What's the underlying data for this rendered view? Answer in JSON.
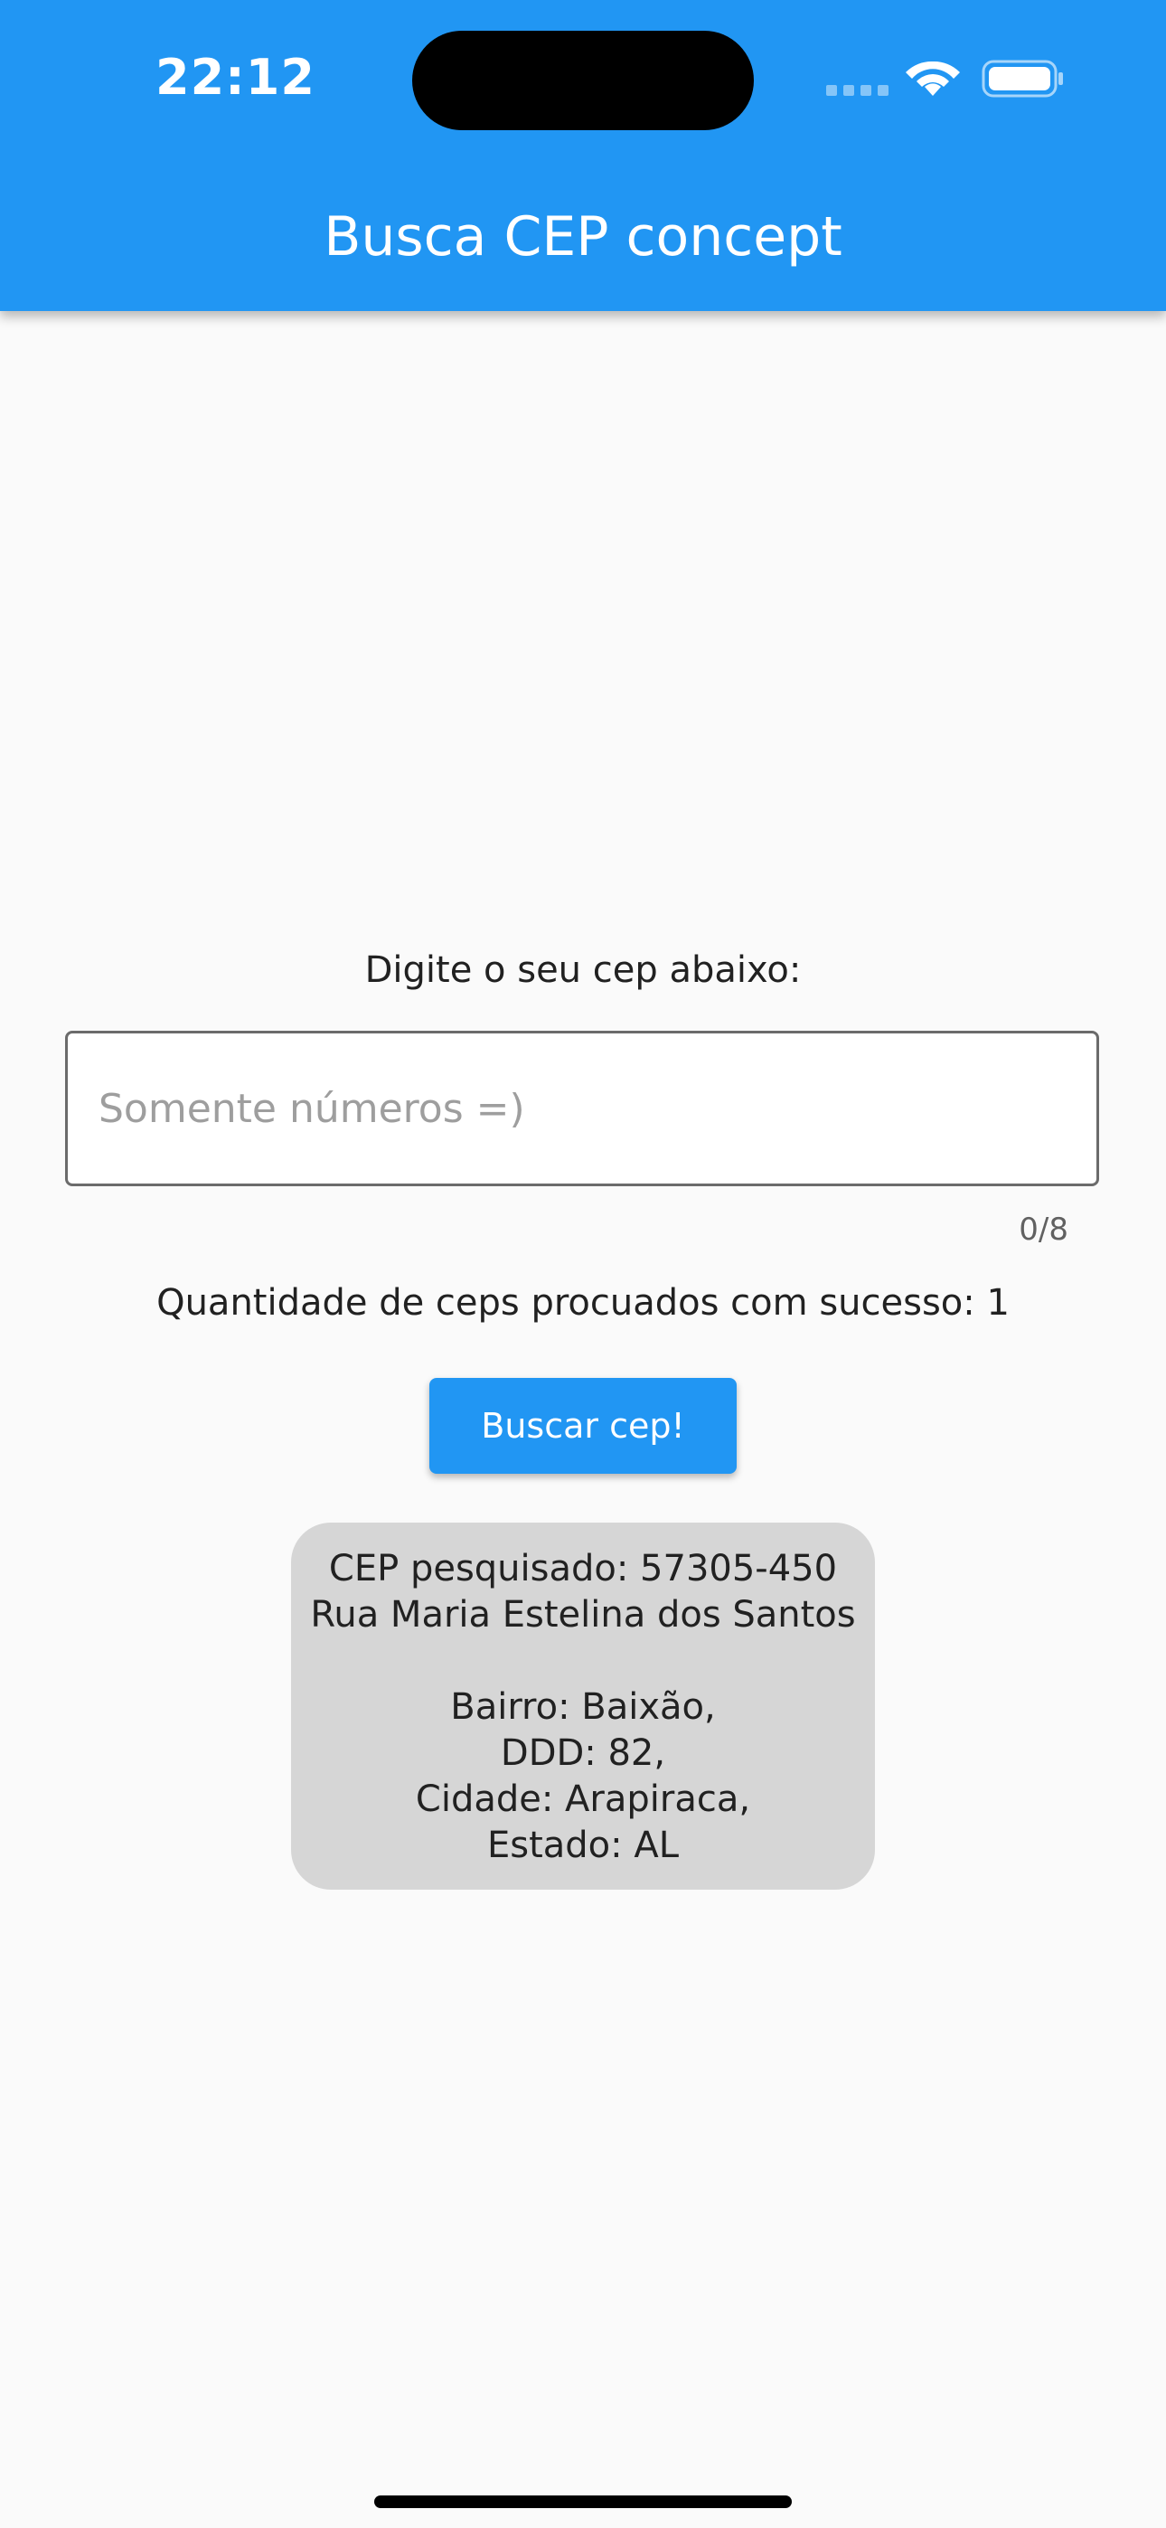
{
  "status_bar": {
    "time": "22:12"
  },
  "app_bar": {
    "title": "Busca CEP concept",
    "color": "#2196f3"
  },
  "form": {
    "prompt": "Digite o seu cep abaixo:",
    "input_value": "",
    "input_placeholder": "Somente números =)",
    "counter": "0/8",
    "success_count_text": "Quantidade de ceps procuados com sucesso: 1",
    "button_label": "Buscar cep!"
  },
  "result": {
    "cep_line": "CEP pesquisado: 57305-450",
    "street": "Rua Maria Estelina dos Santos",
    "neighborhood": "Bairro: Baixão,",
    "ddd": "DDD: 82,",
    "city": "Cidade: Arapiraca,",
    "state": "Estado: AL"
  },
  "icons": [
    "wifi-icon",
    "battery-icon",
    "signal-dots-icon"
  ]
}
